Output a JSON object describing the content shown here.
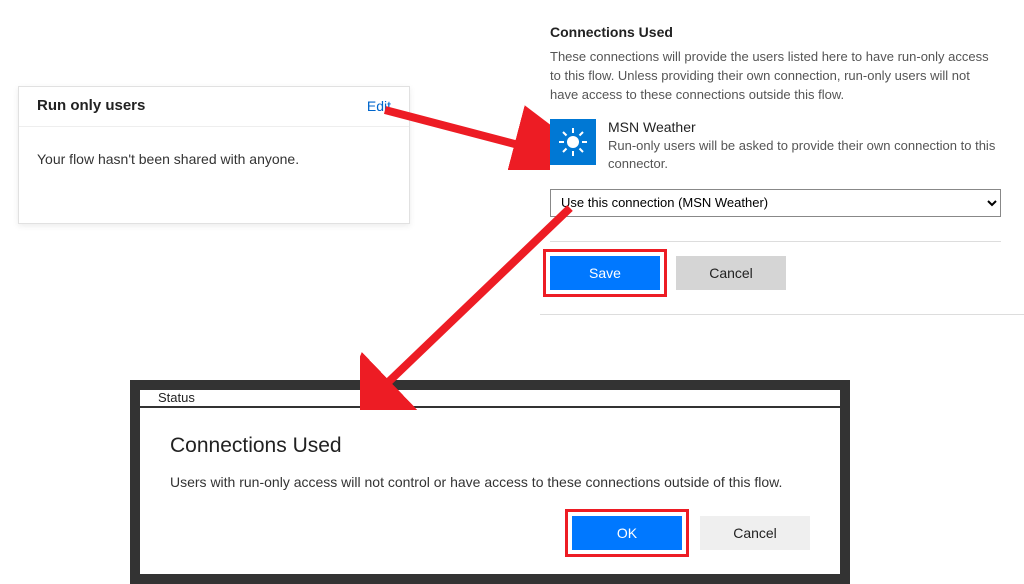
{
  "run_only_card": {
    "title": "Run only users",
    "edit_label": "Edit",
    "body_text": "Your flow hasn't been shared with anyone."
  },
  "connections_panel": {
    "section_title": "Connections Used",
    "description": "These connections will provide the users listed here to have run-only access to this flow. Unless providing their own connection, run-only users will not have access to these connections outside this flow.",
    "connector": {
      "name": "MSN Weather",
      "subtext": "Run-only users will be asked to provide their own connection to this connector."
    },
    "dropdown_selected": "Use this connection (MSN Weather)",
    "save_label": "Save",
    "cancel_label": "Cancel"
  },
  "dialog": {
    "status_peek": "Status",
    "title": "Connections Used",
    "text": "Users with run-only access will not control or have access to these connections outside of this flow.",
    "ok_label": "OK",
    "cancel_label": "Cancel"
  },
  "colors": {
    "accent": "#0078ff",
    "highlight": "#ed1c24"
  }
}
